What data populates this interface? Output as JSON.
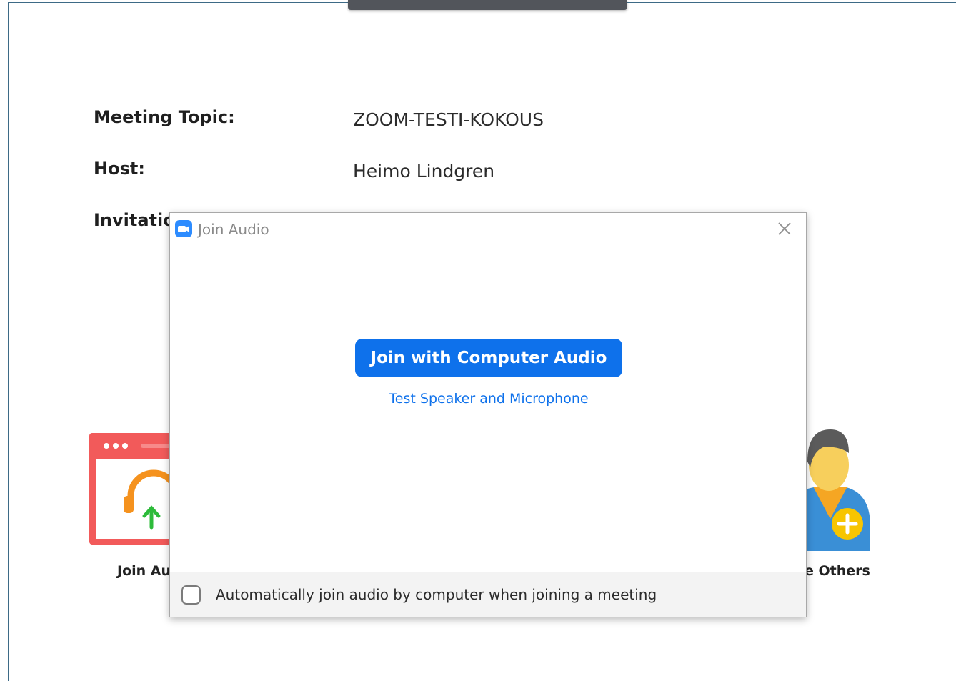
{
  "meeting": {
    "topic_label": "Meeting Topic:",
    "topic_value": "ZOOM-TESTI-KOKOUS",
    "host_label": "Host:",
    "host_value": "Heimo Lindgren",
    "invitation_label": "Invitation"
  },
  "background_options": {
    "left_label": "Join Au",
    "right_label": "e Others"
  },
  "dialog": {
    "title": "Join Audio",
    "primary_button": "Join with Computer Audio",
    "secondary_link": "Test Speaker and Microphone",
    "auto_join_checkbox": {
      "label": "Automatically join audio by computer when joining a meeting",
      "checked": false
    }
  },
  "colors": {
    "accent": "#0e71eb",
    "headset_orange": "#f5921e",
    "arrow_green": "#2dbb3a",
    "window_red": "#f25a5a"
  },
  "icons": {
    "dialog_app": "zoom-camera-icon",
    "close": "close-icon",
    "join_audio_option": "headset-upload-icon",
    "invite_option": "add-person-icon"
  }
}
